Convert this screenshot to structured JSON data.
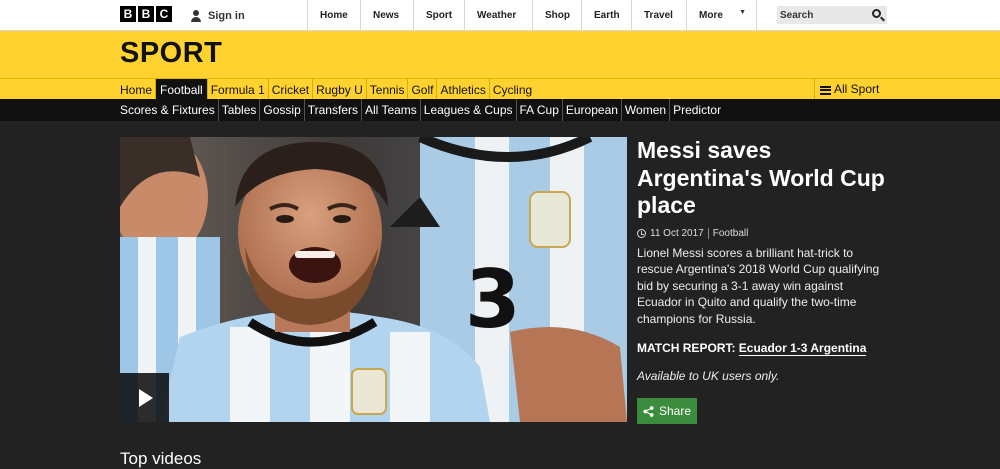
{
  "topbar": {
    "logo_letters": [
      "B",
      "B",
      "C"
    ],
    "signin_label": "Sign in",
    "nav": [
      "Home",
      "News",
      "Sport",
      "Weather",
      "Shop",
      "Earth",
      "Travel",
      "More"
    ],
    "search_placeholder": "Search"
  },
  "sport_header": {
    "title": "SPORT",
    "nav": [
      "Home",
      "Football",
      "Formula 1",
      "Cricket",
      "Rugby U",
      "Tennis",
      "Golf",
      "Athletics",
      "Cycling"
    ],
    "active": "Football",
    "all_sport_label": "All Sport"
  },
  "subnav": [
    "Scores & Fixtures",
    "Tables",
    "Gossip",
    "Transfers",
    "All Teams",
    "Leagues & Cups",
    "FA Cup",
    "European",
    "Women",
    "Predictor"
  ],
  "story": {
    "headline": "Messi saves Argentina's World Cup place",
    "date": "11 Oct 2017",
    "category": "Football",
    "summary": "Lionel Messi scores a brilliant hat-trick to rescue Argentina's 2018 World Cup qualifying bid by securing a 3-1 away win against Ecuador in Quito and qualify the two-time champions for Russia.",
    "report_prefix": "MATCH REPORT:",
    "report_link": "Ecuador 1-3 Argentina",
    "availability": "Available to UK users only.",
    "share_label": "Share"
  },
  "sections": {
    "top_videos": "Top videos"
  },
  "colors": {
    "sport_yellow": "#ffd230",
    "page_dark": "#222222",
    "share_green": "#3b8d3d"
  }
}
